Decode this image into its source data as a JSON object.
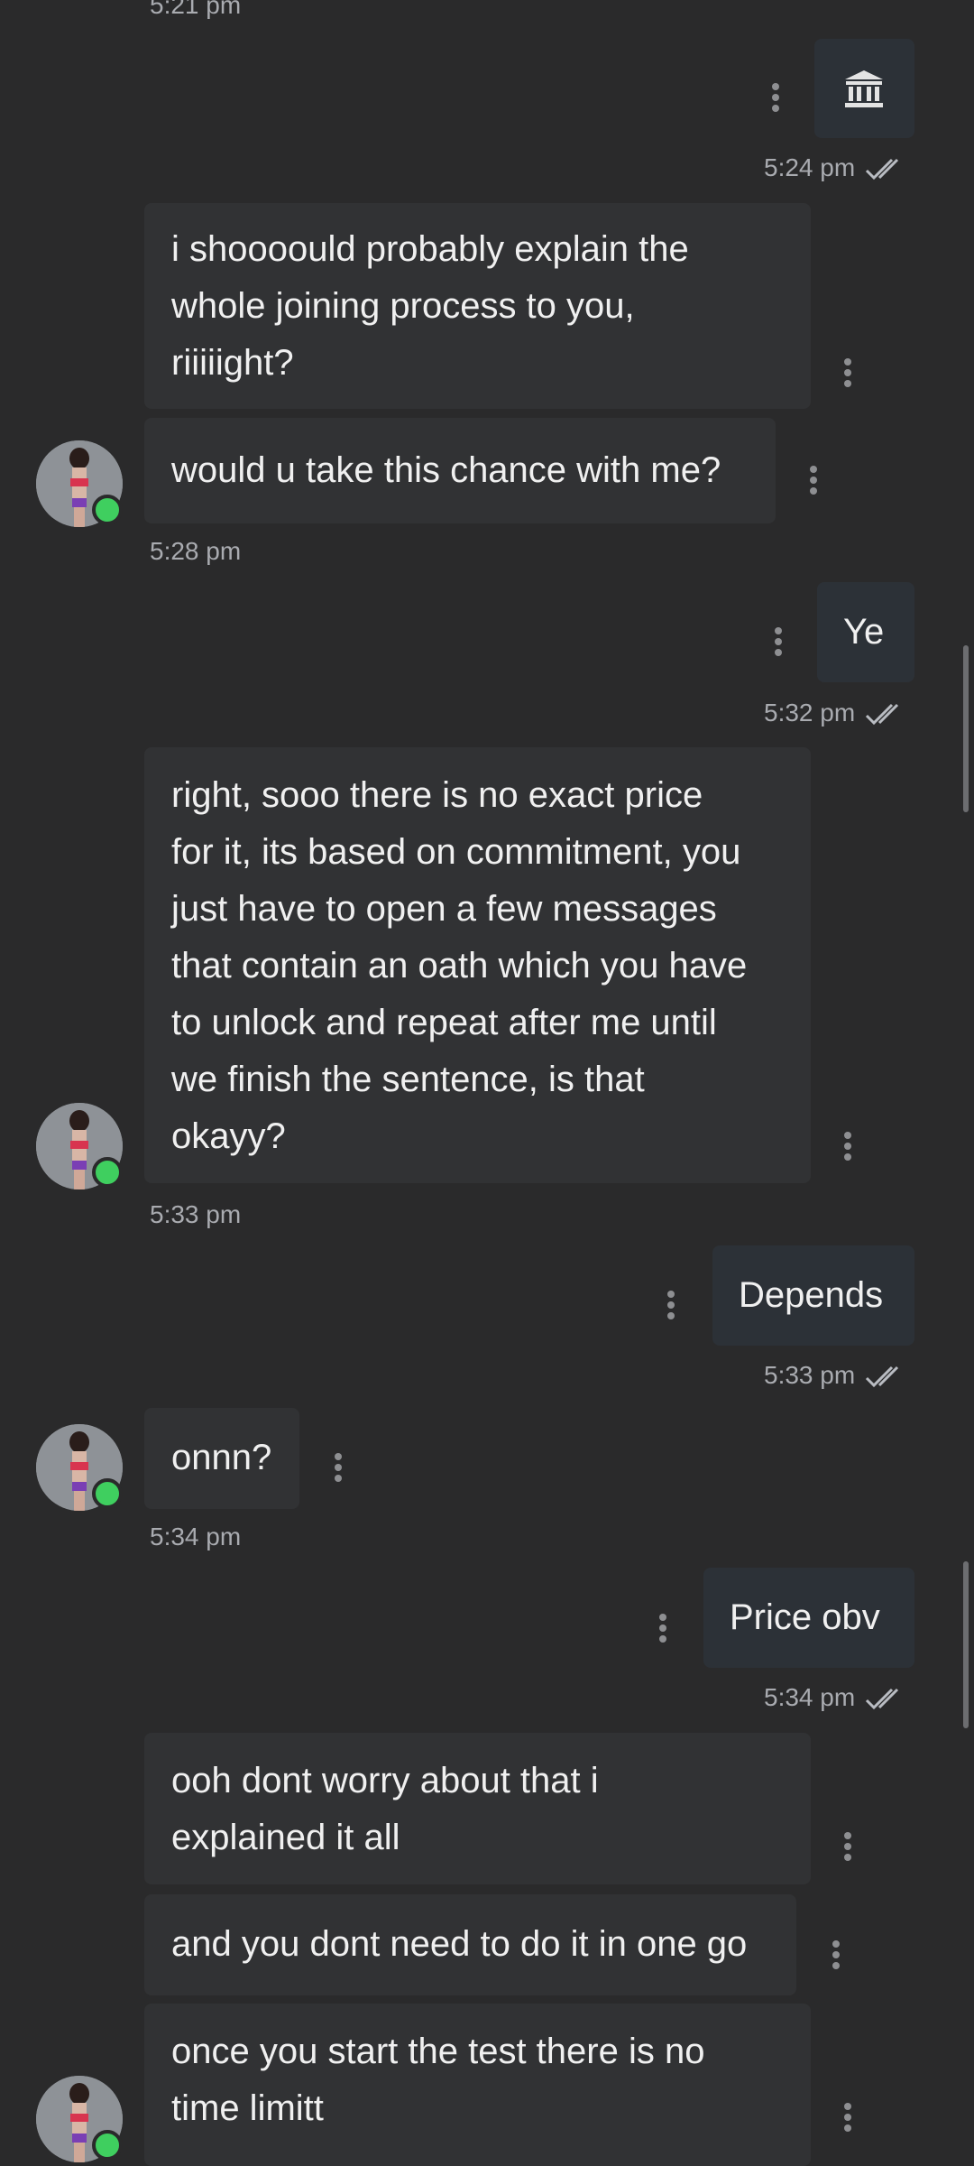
{
  "messages": [
    {
      "id": "m0",
      "time": "5:21 pm"
    },
    {
      "id": "m1",
      "icon": "bank-icon",
      "time": "5:24 pm"
    },
    {
      "id": "m2",
      "lines": [
        "i shoooould probably explain the",
        "whole joining process to you,",
        "riiiiight?"
      ]
    },
    {
      "id": "m3",
      "lines": [
        "would u take this chance with me?"
      ],
      "time": "5:28 pm"
    },
    {
      "id": "m4",
      "lines": [
        "Ye"
      ],
      "time": "5:32 pm"
    },
    {
      "id": "m5",
      "lines": [
        "right, sooo there is no exact price",
        "for it, its based on commitment, you",
        "just have to open a few messages",
        "that contain an oath which you have",
        "to unlock and repeat after me until",
        "we finish the sentence, is that",
        "okayy?"
      ],
      "time": "5:33 pm"
    },
    {
      "id": "m6",
      "lines": [
        "Depends"
      ],
      "time": "5:33 pm"
    },
    {
      "id": "m7",
      "lines": [
        "onnn?"
      ],
      "time": "5:34 pm"
    },
    {
      "id": "m8",
      "lines": [
        "Price obv"
      ],
      "time": "5:34 pm"
    },
    {
      "id": "m9",
      "lines": [
        "ooh dont worry about that i",
        "explained it all"
      ]
    },
    {
      "id": "m10",
      "lines": [
        "and you dont need to do it in one go"
      ]
    },
    {
      "id": "m11",
      "lines": [
        "once you start the test there is no",
        "time limitt"
      ]
    }
  ],
  "colors": {
    "background": "#2a2a2b",
    "incoming_bubble": "#313234",
    "outgoing_bubble": "#2c3137",
    "online": "#3fcf5f",
    "timestamp": "#a9abb0"
  }
}
